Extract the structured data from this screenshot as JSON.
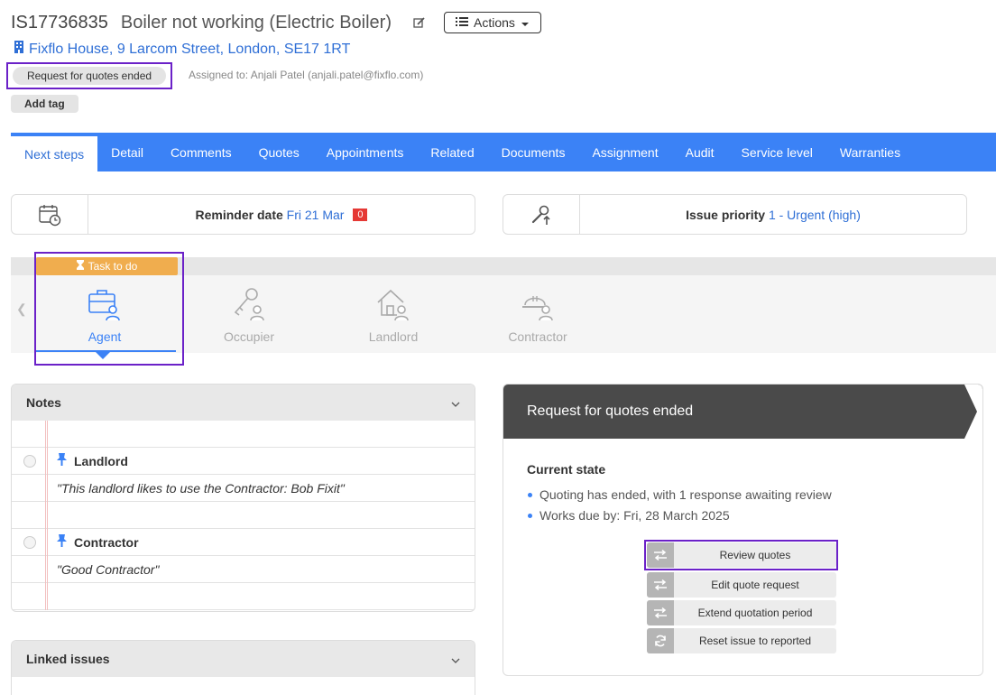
{
  "header": {
    "issue_id": "IS17736835",
    "title": "Boiler not working (Electric Boiler)",
    "actions_label": "Actions",
    "address": "Fixflo House, 9 Larcom Street, London, SE17 1RT",
    "status": "Request for quotes ended",
    "assigned": "Assigned to: Anjali Patel (anjali.patel@fixflo.com)",
    "add_tag": "Add tag"
  },
  "tabs": [
    {
      "label": "Next steps"
    },
    {
      "label": "Detail"
    },
    {
      "label": "Comments"
    },
    {
      "label": "Quotes"
    },
    {
      "label": "Appointments"
    },
    {
      "label": "Related"
    },
    {
      "label": "Documents"
    },
    {
      "label": "Assignment"
    },
    {
      "label": "Audit"
    },
    {
      "label": "Service level"
    },
    {
      "label": "Warranties"
    }
  ],
  "reminder": {
    "label": "Reminder date",
    "value": "Fri 21 Mar",
    "count": "0"
  },
  "priority": {
    "label": "Issue priority",
    "value": "1 - Urgent (high)"
  },
  "task_tag": "Task to do",
  "roles": [
    {
      "label": "Agent",
      "icon": "briefcase-person-icon"
    },
    {
      "label": "Occupier",
      "icon": "key-person-icon"
    },
    {
      "label": "Landlord",
      "icon": "house-person-icon"
    },
    {
      "label": "Contractor",
      "icon": "hardhat-person-icon"
    }
  ],
  "notes": {
    "title": "Notes",
    "items": [
      {
        "title": "Landlord",
        "text": "\"This landlord likes to use the Contractor: Bob Fixit\""
      },
      {
        "title": "Contractor",
        "text": "\"Good Contractor\""
      }
    ]
  },
  "linked_issues": {
    "title": "Linked issues"
  },
  "state": {
    "title": "Request for quotes ended",
    "current_state_label": "Current state",
    "bullets": [
      "Quoting has ended, with 1 response awaiting review",
      "Works due by: Fri, 28 March 2025"
    ],
    "buttons": [
      {
        "label": "Review quotes",
        "icon": "swap-arrows-icon"
      },
      {
        "label": "Edit quote request",
        "icon": "swap-arrows-icon"
      },
      {
        "label": "Extend quotation period",
        "icon": "swap-arrows-icon"
      },
      {
        "label": "Reset issue to reported",
        "icon": "refresh-icon"
      }
    ]
  },
  "colors": {
    "accent": "#3b82f6",
    "highlight": "#6b21c8",
    "task": "#f0ad4e",
    "badge": "#e53935"
  }
}
